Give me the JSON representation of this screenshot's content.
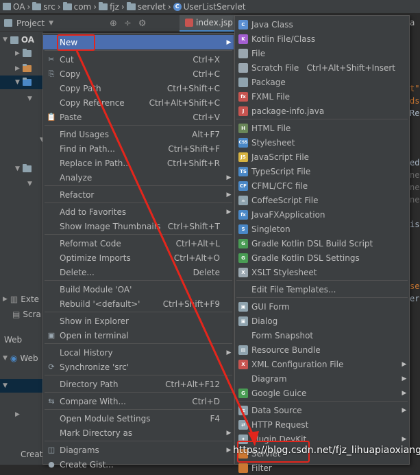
{
  "breadcrumb": [
    {
      "icon": "module-icon",
      "label": "OA"
    },
    {
      "icon": "folder-icon",
      "label": "src"
    },
    {
      "icon": "folder-icon",
      "label": "com"
    },
    {
      "icon": "folder-icon",
      "label": "fjz"
    },
    {
      "icon": "folder-icon",
      "label": "servlet"
    },
    {
      "icon": "class-icon",
      "label": "UserListServlet"
    }
  ],
  "project_panel": {
    "title": "Project",
    "root_label": "OA",
    "tree_fragments": [
      "Exte",
      "Scra"
    ],
    "web_section": "Web",
    "web_item": "Web",
    "bottom_label": "Creat"
  },
  "editor": {
    "tab_label": "index.jsp",
    "side_tab": "a"
  },
  "context_menu": {
    "items": [
      {
        "label": "New",
        "shortcut": "",
        "submenu": true,
        "icon": "",
        "highlighted": true
      },
      {
        "sep": true
      },
      {
        "label": "Cut",
        "shortcut": "Ctrl+X",
        "icon": "scissors-icon"
      },
      {
        "label": "Copy",
        "shortcut": "Ctrl+C",
        "icon": "copy-icon"
      },
      {
        "label": "Copy Path",
        "shortcut": "Ctrl+Shift+C"
      },
      {
        "label": "Copy Reference",
        "shortcut": "Ctrl+Alt+Shift+C"
      },
      {
        "label": "Paste",
        "shortcut": "Ctrl+V",
        "icon": "paste-icon"
      },
      {
        "sep": true
      },
      {
        "label": "Find Usages",
        "shortcut": "Alt+F7"
      },
      {
        "label": "Find in Path...",
        "shortcut": "Ctrl+Shift+F"
      },
      {
        "label": "Replace in Path...",
        "shortcut": "Ctrl+Shift+R"
      },
      {
        "label": "Analyze",
        "submenu": true
      },
      {
        "sep": true
      },
      {
        "label": "Refactor",
        "submenu": true
      },
      {
        "sep": true
      },
      {
        "label": "Add to Favorites",
        "submenu": true
      },
      {
        "label": "Show Image Thumbnails",
        "shortcut": "Ctrl+Shift+T"
      },
      {
        "sep": true
      },
      {
        "label": "Reformat Code",
        "shortcut": "Ctrl+Alt+L"
      },
      {
        "label": "Optimize Imports",
        "shortcut": "Ctrl+Alt+O"
      },
      {
        "label": "Delete...",
        "shortcut": "Delete"
      },
      {
        "sep": true
      },
      {
        "label": "Build Module 'OA'"
      },
      {
        "label": "Rebuild '<default>'",
        "shortcut": "Ctrl+Shift+F9"
      },
      {
        "sep": true
      },
      {
        "label": "Show in Explorer"
      },
      {
        "label": "Open in terminal",
        "icon": "terminal-icon"
      },
      {
        "sep": true
      },
      {
        "label": "Local History",
        "submenu": true
      },
      {
        "label": "Synchronize 'src'",
        "icon": "sync-icon"
      },
      {
        "sep": true
      },
      {
        "label": "Directory Path",
        "shortcut": "Ctrl+Alt+F12"
      },
      {
        "sep": true
      },
      {
        "label": "Compare With...",
        "shortcut": "Ctrl+D",
        "icon": "compare-icon"
      },
      {
        "sep": true
      },
      {
        "label": "Open Module Settings",
        "shortcut": "F4"
      },
      {
        "label": "Mark Directory as",
        "submenu": true
      },
      {
        "sep": true
      },
      {
        "label": "Diagrams",
        "submenu": true,
        "icon": "diagram-icon"
      },
      {
        "label": "Create Gist...",
        "icon": "github-icon"
      }
    ]
  },
  "new_submenu": {
    "items": [
      {
        "label": "Java Class",
        "icon": "java-class-icon",
        "color": "#5a8ed1",
        "glyph": "C"
      },
      {
        "label": "Kotlin File/Class",
        "icon": "kotlin-icon",
        "color": "#a35fd1",
        "glyph": "K"
      },
      {
        "label": "File",
        "icon": "file-icon",
        "color": "#9aa7b0",
        "glyph": ""
      },
      {
        "label": "Scratch File",
        "shortcut": "Ctrl+Alt+Shift+Insert",
        "icon": "scratch-icon",
        "color": "#9aa7b0",
        "glyph": ""
      },
      {
        "label": "Package",
        "icon": "package-icon",
        "color": "#8fa3ae",
        "glyph": ""
      },
      {
        "label": "FXML File",
        "icon": "fxml-icon",
        "color": "#c75450",
        "glyph": "fx"
      },
      {
        "label": "package-info.java",
        "icon": "package-info-icon",
        "color": "#c75450",
        "glyph": "J"
      },
      {
        "sep": true
      },
      {
        "label": "HTML File",
        "icon": "html-icon",
        "color": "#6a8759",
        "glyph": "H"
      },
      {
        "label": "Stylesheet",
        "icon": "css-icon",
        "color": "#4a88c7",
        "glyph": "CSS"
      },
      {
        "label": "JavaScript File",
        "icon": "javascript-icon",
        "color": "#d6b341",
        "glyph": "JS"
      },
      {
        "label": "TypeScript File",
        "icon": "typescript-icon",
        "color": "#4a88c7",
        "glyph": "TS"
      },
      {
        "label": "CFML/CFC file",
        "icon": "cfml-icon",
        "color": "#4a88c7",
        "glyph": "CF"
      },
      {
        "label": "CoffeeScript File",
        "icon": "coffeescript-icon",
        "color": "#8fa3ae",
        "glyph": "☕"
      },
      {
        "label": "JavaFXApplication",
        "icon": "javafx-icon",
        "color": "#4a88c7",
        "glyph": "fx"
      },
      {
        "label": "Singleton",
        "icon": "singleton-icon",
        "color": "#4a88c7",
        "glyph": "S"
      },
      {
        "label": "Gradle Kotlin DSL Build Script",
        "icon": "gradle-icon",
        "color": "#499c54",
        "glyph": "G"
      },
      {
        "label": "Gradle Kotlin DSL Settings",
        "icon": "gradle-icon",
        "color": "#499c54",
        "glyph": "G"
      },
      {
        "label": "XSLT Stylesheet",
        "icon": "xslt-icon",
        "color": "#9aa7b0",
        "glyph": "X"
      },
      {
        "sep": true
      },
      {
        "label": "Edit File Templates...",
        "icon": "",
        "color": "",
        "glyph": ""
      },
      {
        "sep": true
      },
      {
        "label": "GUI Form",
        "icon": "gui-form-icon",
        "color": "#8fa3ae",
        "glyph": "▣"
      },
      {
        "label": "Dialog",
        "icon": "dialog-icon",
        "color": "#8fa3ae",
        "glyph": "▣"
      },
      {
        "label": "Form Snapshot",
        "icon": "",
        "color": "",
        "glyph": ""
      },
      {
        "label": "Resource Bundle",
        "icon": "resource-bundle-icon",
        "color": "#8fa3ae",
        "glyph": "▤"
      },
      {
        "label": "XML Configuration File",
        "submenu": true,
        "icon": "xml-icon",
        "color": "#c75450",
        "glyph": "X"
      },
      {
        "label": "Diagram",
        "submenu": true,
        "icon": "",
        "color": "",
        "glyph": ""
      },
      {
        "label": "Google Guice",
        "submenu": true,
        "icon": "guice-icon",
        "color": "#499c54",
        "glyph": "G"
      },
      {
        "sep": true
      },
      {
        "label": "Data Source",
        "submenu": true,
        "icon": "data-source-icon",
        "color": "#8fa3ae",
        "glyph": "≡"
      },
      {
        "label": "HTTP Request",
        "icon": "http-request-icon",
        "color": "#8fa3ae",
        "glyph": "⇄"
      },
      {
        "label": "Plugin DevKit",
        "submenu": true,
        "icon": "plugin-icon",
        "color": "#8fa3ae",
        "glyph": "✦"
      },
      {
        "label": "Servlet",
        "icon": "servlet-icon",
        "color": "#cc7832",
        "glyph": ""
      },
      {
        "label": "Filter",
        "icon": "filter-icon",
        "color": "#cc7832",
        "glyph": ""
      }
    ]
  },
  "watermark": "https://blog.csdn.net/fjz_lihuapiaoxiang",
  "colors": {
    "background": "#2b2b2b",
    "panel": "#3c3f41",
    "highlight": "#4b6eaf",
    "annotation": "#e3261c"
  }
}
